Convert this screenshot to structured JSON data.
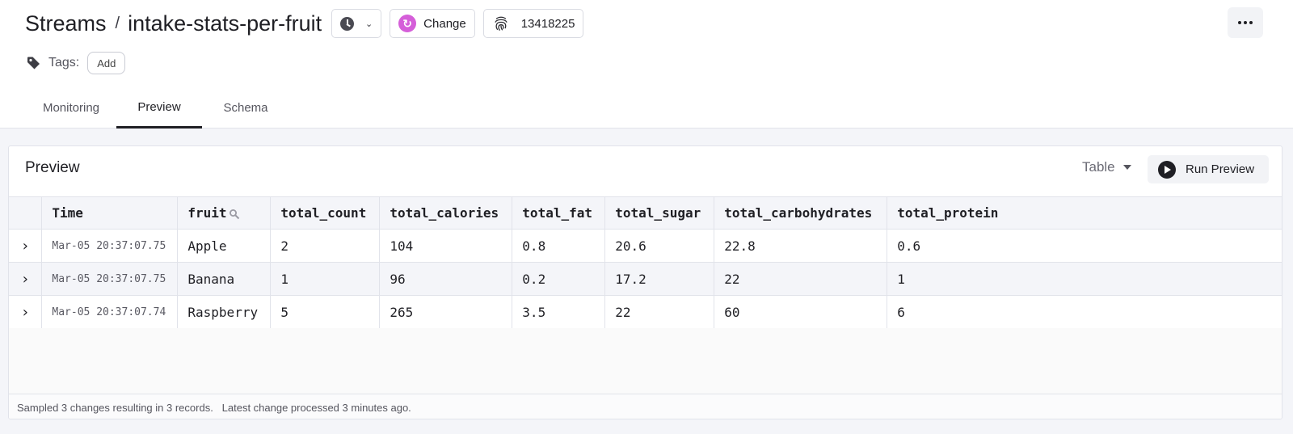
{
  "header": {
    "breadcrumb_root": "Streams",
    "breadcrumb_separator": "/",
    "page_name": "intake-stats-per-fruit",
    "change_label": "Change",
    "fingerprint_value": "13418225",
    "tags_label": "Tags:",
    "add_tag_label": "Add"
  },
  "tabs": [
    {
      "label": "Monitoring"
    },
    {
      "label": "Preview",
      "active": true
    },
    {
      "label": "Schema"
    }
  ],
  "preview": {
    "title": "Preview",
    "view_mode": "Table",
    "run_label": "Run Preview",
    "columns": [
      "Time",
      "fruit",
      "total_count",
      "total_calories",
      "total_fat",
      "total_sugar",
      "total_carbohydrates",
      "total_protein"
    ],
    "rows": [
      {
        "time": "Mar-05 20:37:07.75",
        "fruit": "Apple",
        "total_count": "2",
        "total_calories": "104",
        "total_fat": "0.8",
        "total_sugar": "20.6",
        "total_carbohydrates": "22.8",
        "total_protein": "0.6"
      },
      {
        "time": "Mar-05 20:37:07.75",
        "fruit": "Banana",
        "total_count": "1",
        "total_calories": "96",
        "total_fat": "0.2",
        "total_sugar": "17.2",
        "total_carbohydrates": "22",
        "total_protein": "1"
      },
      {
        "time": "Mar-05 20:37:07.74",
        "fruit": "Raspberry",
        "total_count": "5",
        "total_calories": "265",
        "total_fat": "3.5",
        "total_sugar": "22",
        "total_carbohydrates": "60",
        "total_protein": "6"
      }
    ],
    "footer": "Sampled 3 changes resulting in 3 records.   Latest change processed 3 minutes ago."
  },
  "colors": {
    "change_icon": "#d55fd9",
    "text": "#1f1f24",
    "background": "#f4f5f9"
  },
  "icons": {
    "time_picker": "clock-icon",
    "change": "change-cycle-icon",
    "fingerprint": "fingerprint-icon",
    "more": "more-horizontal-icon",
    "tag": "tag-icon",
    "column_search": "search-icon",
    "run": "play-icon",
    "row_expand": "chevron-right-icon"
  }
}
